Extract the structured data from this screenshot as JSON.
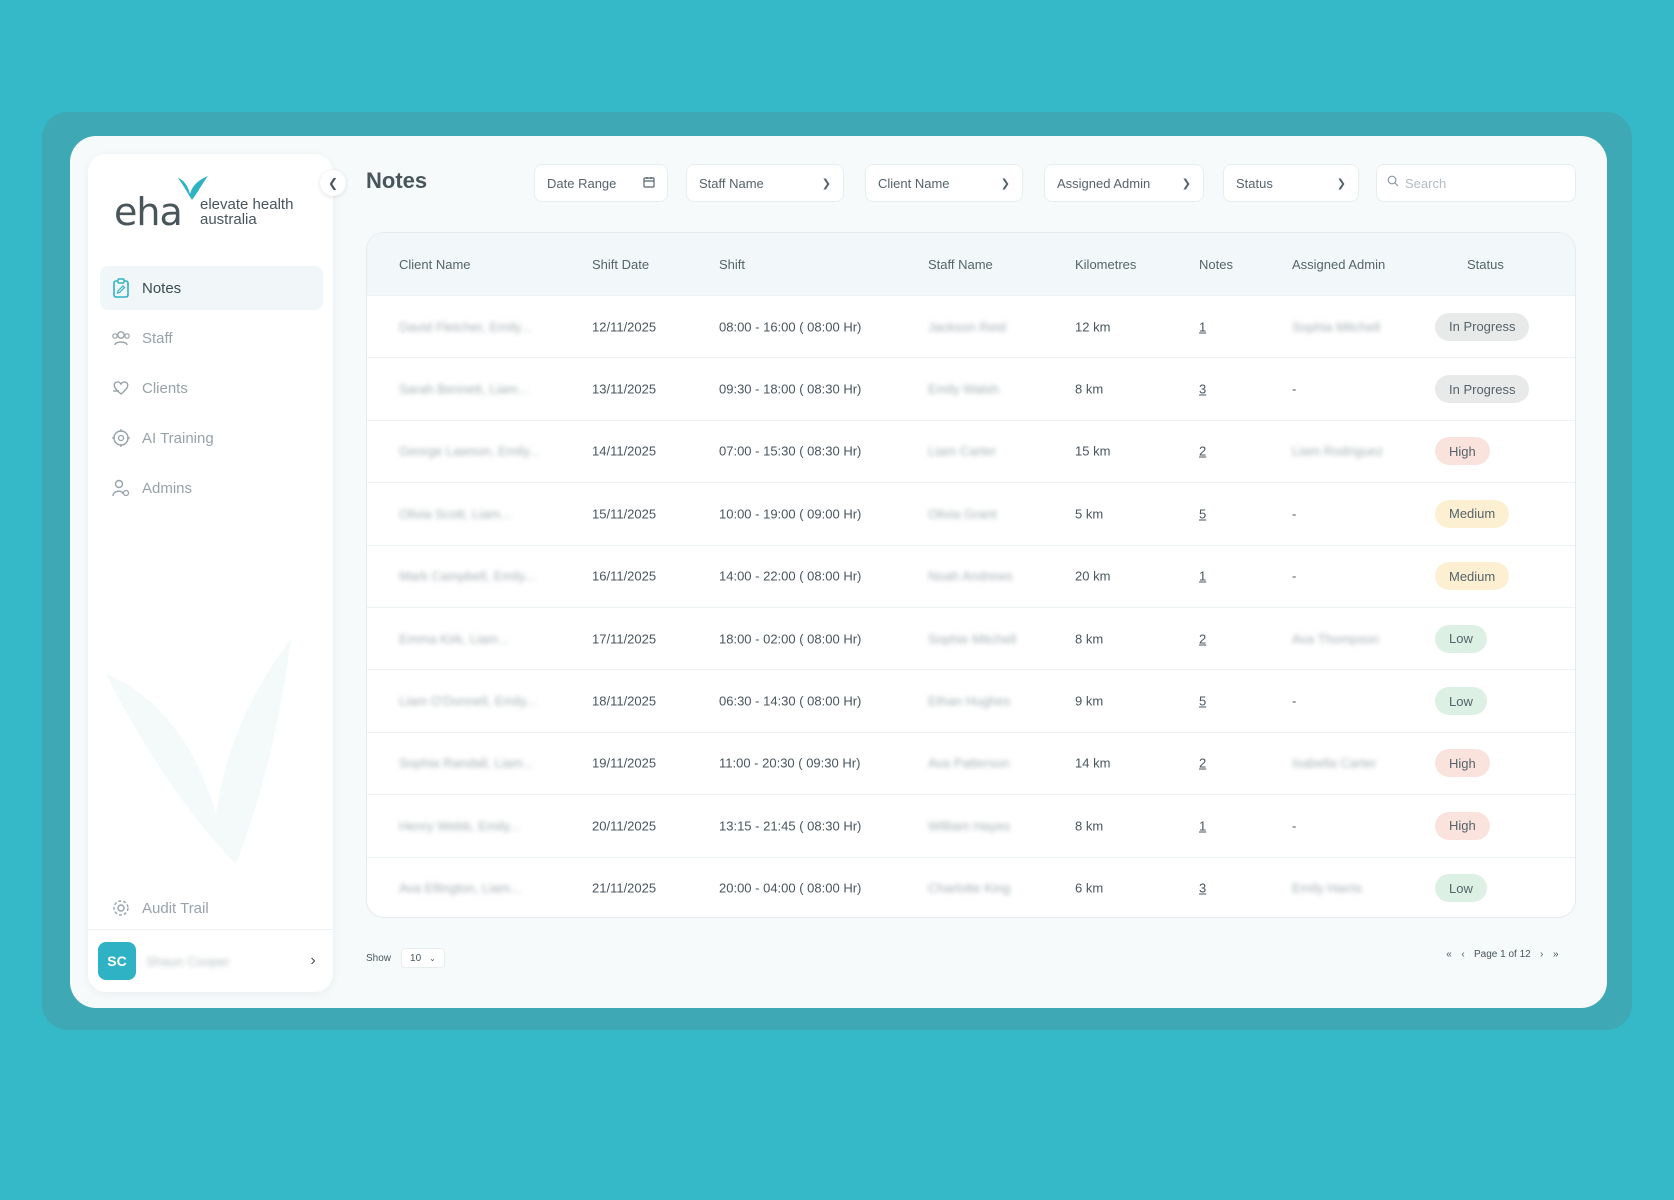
{
  "app": {
    "logo_mark": "eha",
    "logo_line1": "elevate health",
    "logo_line2": "australia"
  },
  "sidebar": {
    "items": [
      {
        "label": "Notes",
        "icon": "clipboard-icon",
        "active": true
      },
      {
        "label": "Staff",
        "icon": "users-icon"
      },
      {
        "label": "Clients",
        "icon": "heart-hand-icon"
      },
      {
        "label": "AI Training",
        "icon": "brain-icon"
      },
      {
        "label": "Admins",
        "icon": "admin-user-icon"
      }
    ],
    "audit_label": "Audit Trail",
    "profile": {
      "initials": "SC",
      "name": "Shaun Cooper"
    }
  },
  "header": {
    "title": "Notes",
    "filters": {
      "date_range": "Date Range",
      "staff_name": "Staff Name",
      "client_name": "Client Name",
      "assigned_admin": "Assigned Admin",
      "status": "Status"
    },
    "search_placeholder": "Search"
  },
  "table": {
    "columns": [
      "Client Name",
      "Shift Date",
      "Shift",
      "Staff Name",
      "Kilometres",
      "Notes",
      "Assigned Admin",
      "Status"
    ],
    "rows": [
      {
        "client": "David Fletcher, Emily...",
        "date": "12/11/2025",
        "shift": "08:00 - 16:00 ( 08:00 Hr)",
        "staff": "Jackson Reid",
        "km": "12 km",
        "notes": "1",
        "admin": "Sophia Mitchell",
        "status": "In Progress",
        "status_type": "progress"
      },
      {
        "client": "Sarah Bennett, Liam...",
        "date": "13/11/2025",
        "shift": "09:30 - 18:00 ( 08:30 Hr)",
        "staff": "Emily Walsh",
        "km": "8 km",
        "notes": "3",
        "admin": "-",
        "status": "In Progress",
        "status_type": "progress"
      },
      {
        "client": "George Lawson, Emily...",
        "date": "14/11/2025",
        "shift": "07:00 - 15:30 ( 08:30 Hr)",
        "staff": "Liam Carter",
        "km": "15 km",
        "notes": "2",
        "admin": "Liam Rodriguez",
        "status": "High",
        "status_type": "high"
      },
      {
        "client": "Olivia Scott, Liam...",
        "date": "15/11/2025",
        "shift": "10:00 - 19:00 ( 09:00 Hr)",
        "staff": "Olivia Grant",
        "km": "5 km",
        "notes": "5",
        "admin": "-",
        "status": "Medium",
        "status_type": "medium"
      },
      {
        "client": "Mark Campbell, Emily...",
        "date": "16/11/2025",
        "shift": "14:00 - 22:00 ( 08:00 Hr)",
        "staff": "Noah Andrews",
        "km": "20 km",
        "notes": "1",
        "admin": "-",
        "status": "Medium",
        "status_type": "medium"
      },
      {
        "client": "Emma Kirk, Liam...",
        "date": "17/11/2025",
        "shift": "18:00 - 02:00 ( 08:00 Hr)",
        "staff": "Sophie Mitchell",
        "km": "8 km",
        "notes": "2",
        "admin": "Ava Thompson",
        "status": "Low",
        "status_type": "low"
      },
      {
        "client": "Liam O'Donnell, Emily...",
        "date": "18/11/2025",
        "shift": "06:30 - 14:30 ( 08:00 Hr)",
        "staff": "Ethan Hughes",
        "km": "9 km",
        "notes": "5",
        "admin": "-",
        "status": "Low",
        "status_type": "low"
      },
      {
        "client": "Sophia Randall, Liam...",
        "date": "19/11/2025",
        "shift": "11:00 - 20:30 ( 09:30 Hr)",
        "staff": "Ava Patterson",
        "km": "14 km",
        "notes": "2",
        "admin": "Isabella Carter",
        "status": "High",
        "status_type": "high"
      },
      {
        "client": "Henry Webb, Emily...",
        "date": "20/11/2025",
        "shift": "13:15 - 21:45 ( 08:30 Hr)",
        "staff": "William Hayes",
        "km": "8 km",
        "notes": "1",
        "admin": "-",
        "status": "High",
        "status_type": "high"
      },
      {
        "client": "Ava Ellington, Liam...",
        "date": "21/11/2025",
        "shift": "20:00 - 04:00 ( 08:00 Hr)",
        "staff": "Charlotte King",
        "km": "6 km",
        "notes": "3",
        "admin": "Emily Harris",
        "status": "Low",
        "status_type": "low"
      }
    ]
  },
  "footer": {
    "show_label": "Show",
    "page_size": "10",
    "page_text": "Page 1 of 12"
  },
  "colors": {
    "background": "#35b8c8",
    "accent": "#2fb3c4",
    "high": "#fbe3dd",
    "medium": "#fdf0d2",
    "low": "#ddf0e4",
    "progress": "#e8eaea"
  }
}
